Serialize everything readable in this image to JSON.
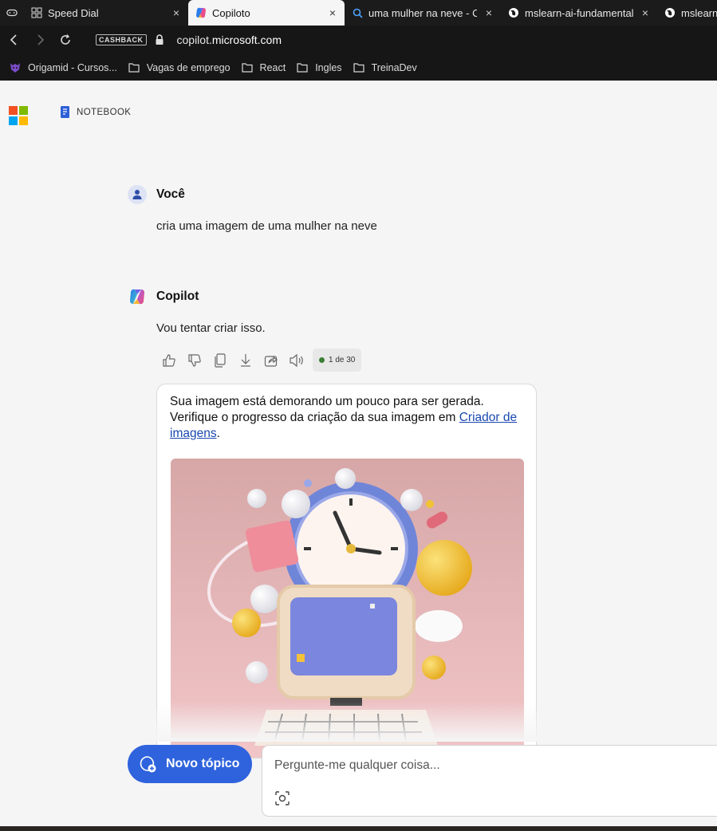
{
  "browser": {
    "tabs": [
      {
        "label": "Speed Dial",
        "icon": "grid-icon",
        "close": "×"
      },
      {
        "label": "Copiloto",
        "icon": "copilot-icon",
        "close": "×"
      },
      {
        "label": "uma mulher na neve - Criad",
        "icon": "search-icon",
        "close": "×"
      },
      {
        "label": "mslearn-ai-fundamentals",
        "icon": "globe-icon",
        "close": "×"
      },
      {
        "label": "mslearn-",
        "icon": "globe-icon",
        "close": ""
      }
    ],
    "cashback_label": "CASHBACK",
    "url_prefix": "copilot.",
    "url_domain": "microsoft.com",
    "bookmarks": [
      {
        "label": "Origamid - Cursos...",
        "icon": "origamid-icon"
      },
      {
        "label": "Vagas de emprego",
        "icon": "folder-icon"
      },
      {
        "label": "React",
        "icon": "folder-icon"
      },
      {
        "label": "Ingles",
        "icon": "folder-icon"
      },
      {
        "label": "TreinaDev",
        "icon": "folder-icon"
      }
    ]
  },
  "header": {
    "notebook_label": "NOTEBOOK"
  },
  "conversation": {
    "user_name": "Você",
    "user_message": "cria uma imagem de uma mulher na neve",
    "bot_name": "Copilot",
    "bot_message": "Vou tentar criar isso.",
    "counter": "1 de 30",
    "card_text_before": "Sua imagem está demorando um pouco para ser gerada. Verifique o progresso da criação da sua imagem em ",
    "card_link": "Criador de imagens",
    "card_text_after": "."
  },
  "composer": {
    "new_topic_label": "Novo tópico",
    "placeholder": "Pergunte-me qualquer coisa..."
  },
  "colors": {
    "accent": "#2f63dd",
    "link": "#1a47b0",
    "counter_dot": "#3a7d34"
  }
}
